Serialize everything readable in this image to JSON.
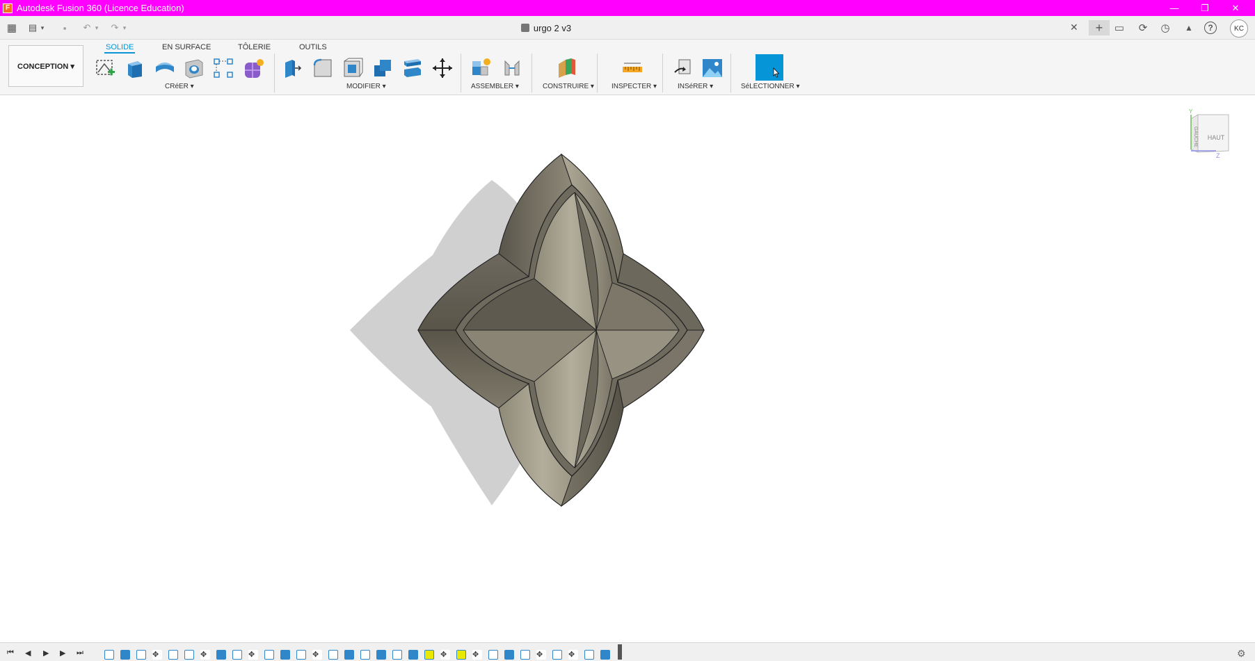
{
  "window": {
    "title": "Autodesk Fusion 360 (Licence Education)",
    "minimize": "—",
    "restore": "❐",
    "close": "✕"
  },
  "document": {
    "name": "urgo 2 v3",
    "close_glyph": "✕"
  },
  "quick_access": {
    "grid_icon": "▦",
    "file_icon": "▤",
    "save_icon": "▪",
    "undo_icon": "↶",
    "redo_icon": "↷",
    "caret": "▾"
  },
  "header_icons": {
    "new_tab": "+",
    "comments": "▭",
    "sync": "⟳",
    "history": "◷",
    "notifications": "▲",
    "help": "?",
    "user_initials": "KC"
  },
  "ribbon": {
    "workspace": "CONCEPTION ▾",
    "tabs": [
      "SOLIDE",
      "EN SURFACE",
      "TÔLERIE",
      "OUTILS"
    ],
    "active_tab": "SOLIDE",
    "groups": {
      "create": "CRéER ▾",
      "modify": "MODIFIER ▾",
      "assemble": "ASSEMBLER ▾",
      "construct": "CONSTRUIRE ▾",
      "inspect": "INSPECTER ▾",
      "insert": "INSéRER ▾",
      "select": "SéLECTIONNER ▾"
    }
  },
  "viewcube": {
    "left_face": "GAUCHE",
    "top_face": "HAUT",
    "axis_y": "Y",
    "axis_z": "Z"
  },
  "timeline": {
    "first": "⏮",
    "prev": "◀",
    "play": "▶",
    "next": "▶",
    "last": "⏭",
    "settings": "⚙"
  },
  "colors": {
    "titlebar": "#ff00ff",
    "accent": "#0696d7",
    "model_dark": "#5e594f",
    "model_light": "#a9a291",
    "shadow": "#d0d0d0"
  }
}
